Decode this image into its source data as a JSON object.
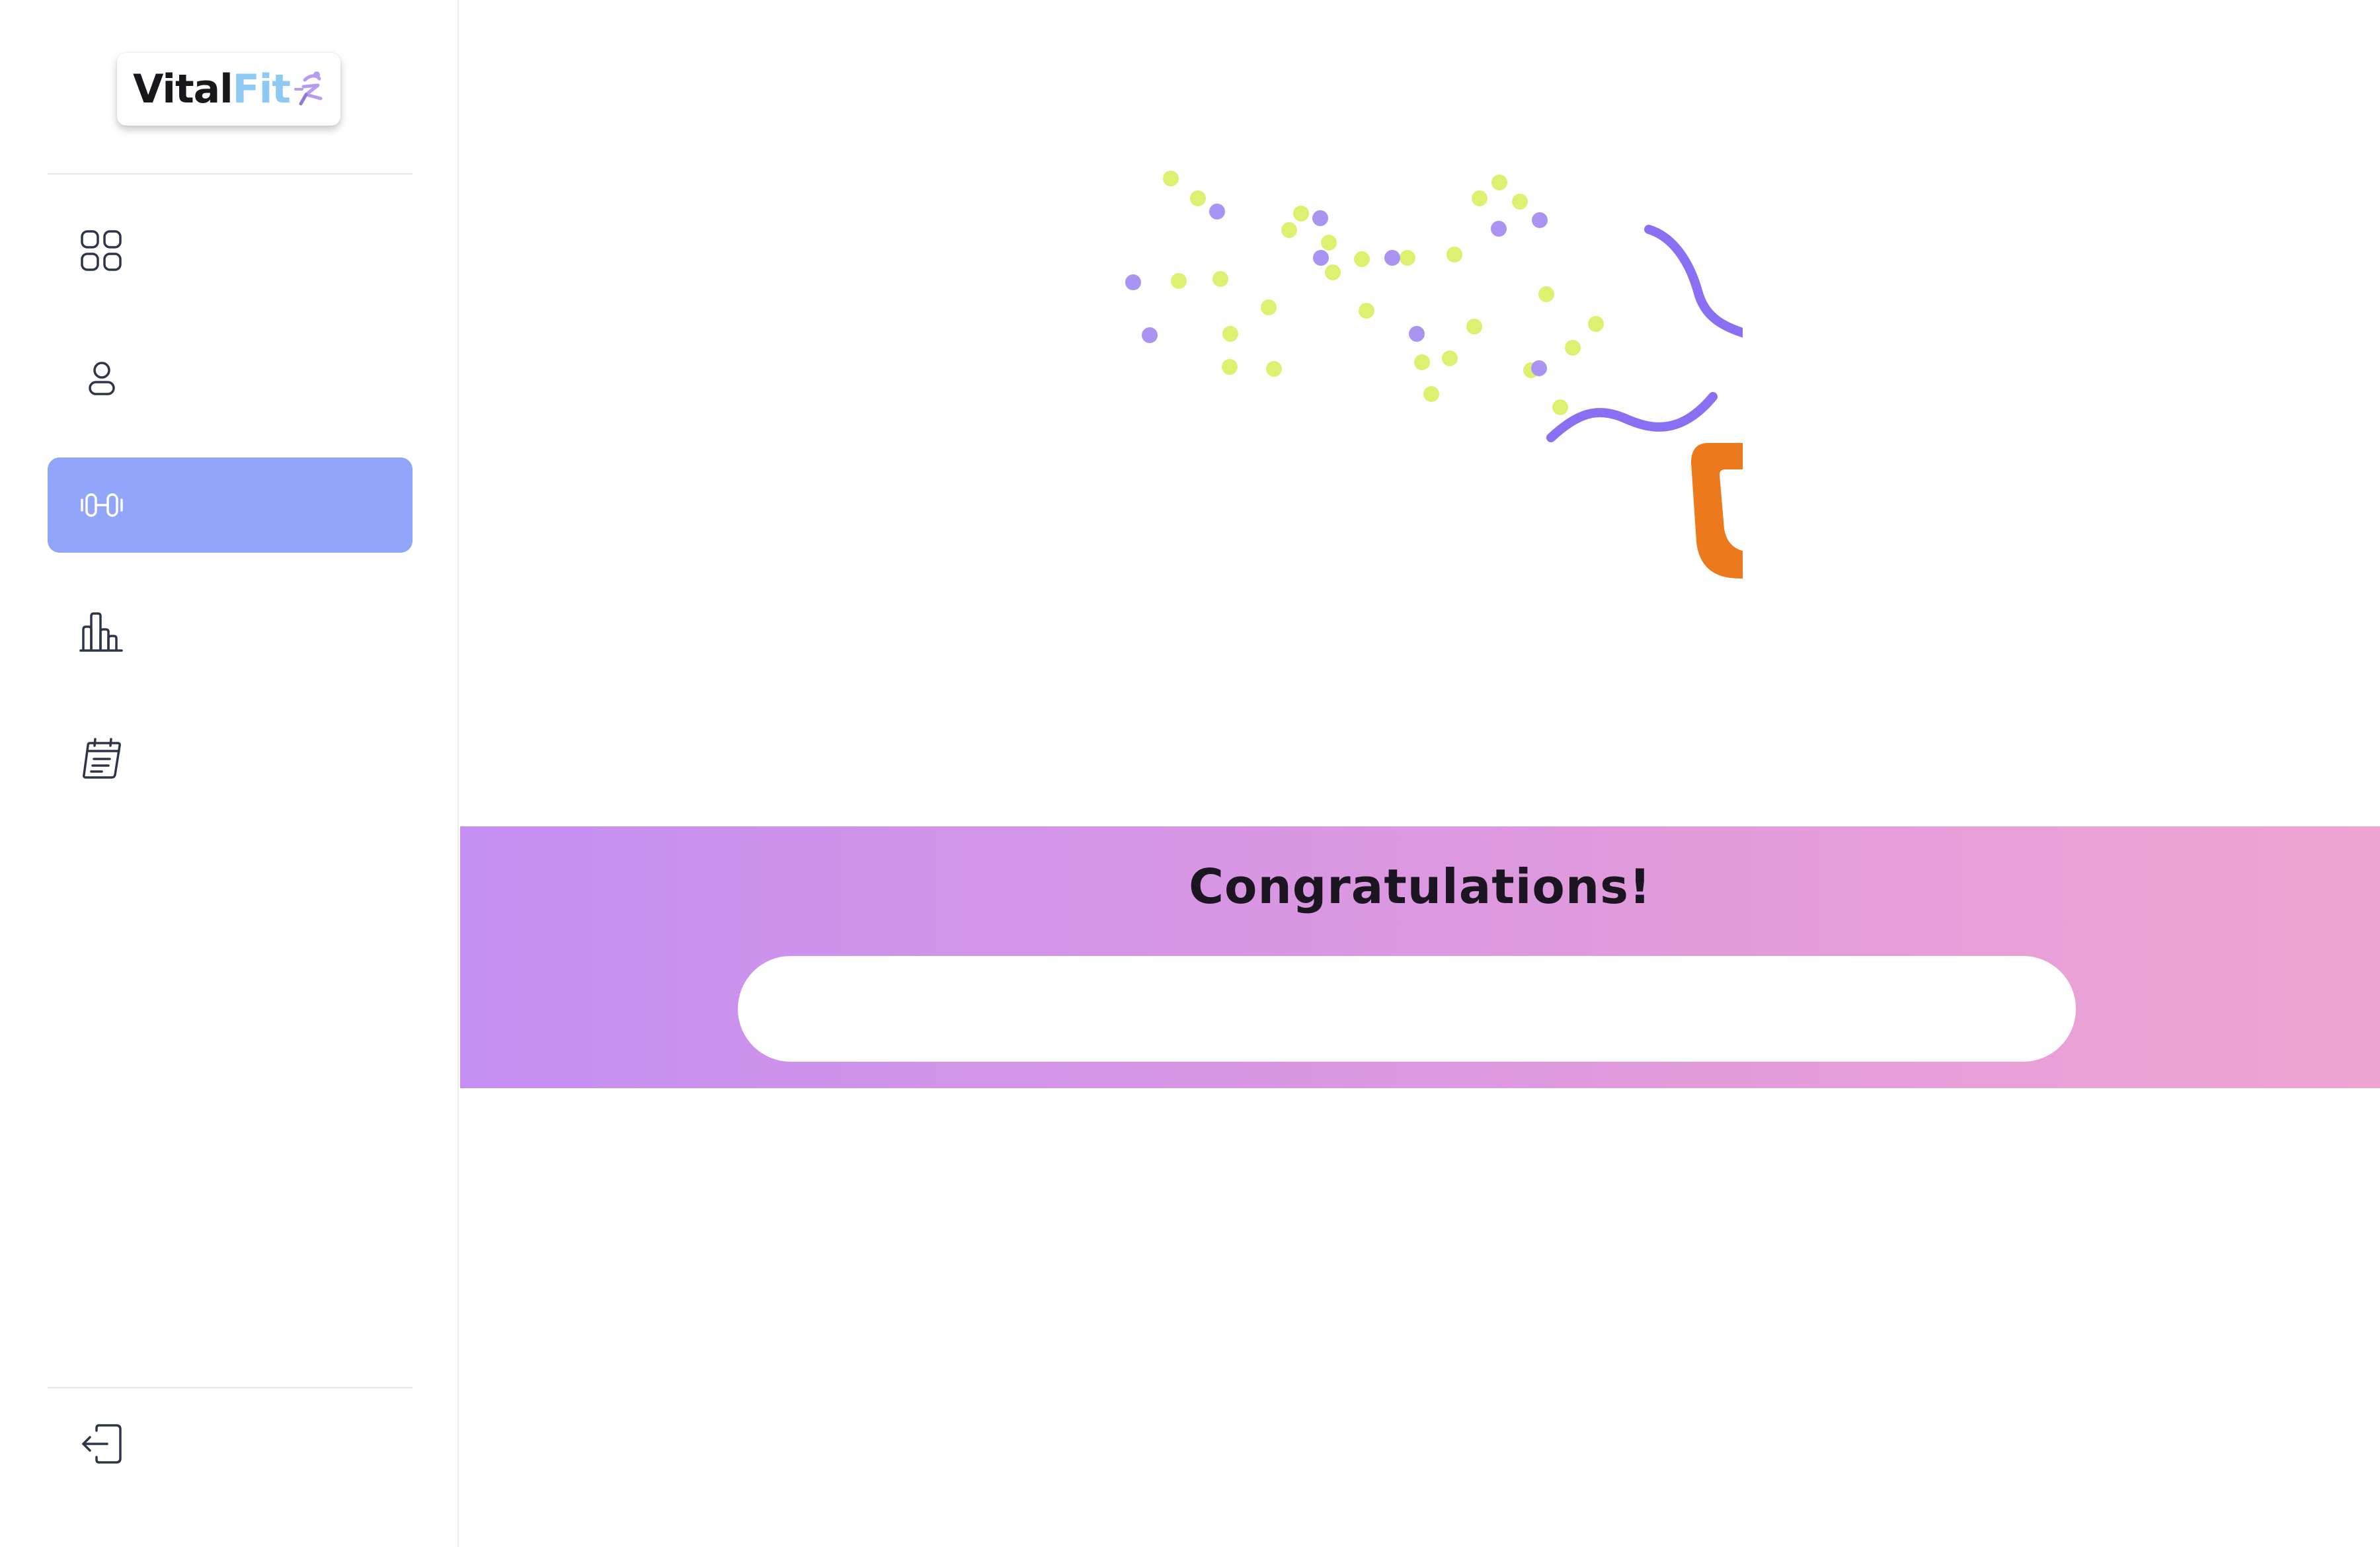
{
  "app": {
    "brand_part1": "Vital",
    "brand_part2": "Fit",
    "brand_colors": {
      "primary_text": "#17171c",
      "fit_text": "#8ec8f5",
      "mark": "#b79af2"
    }
  },
  "sidebar": {
    "items": [
      {
        "id": "dashboard",
        "icon": "grid-icon",
        "active": false
      },
      {
        "id": "profile",
        "icon": "user-icon",
        "active": false
      },
      {
        "id": "workouts",
        "icon": "dumbbell-icon",
        "active": true
      },
      {
        "id": "statistics",
        "icon": "bar-chart-icon",
        "active": false
      },
      {
        "id": "schedule",
        "icon": "calendar-notes-icon",
        "active": false
      }
    ],
    "logout": {
      "icon": "logout-icon"
    },
    "active_color": "#91a6fa",
    "icon_color": "#2e3548"
  },
  "main": {
    "illustration": "trophy-with-confetti",
    "banner": {
      "title": "Congratulations!",
      "message": "",
      "gradient_start": "#c48ff2",
      "gradient_end": "#efa5d2"
    }
  }
}
